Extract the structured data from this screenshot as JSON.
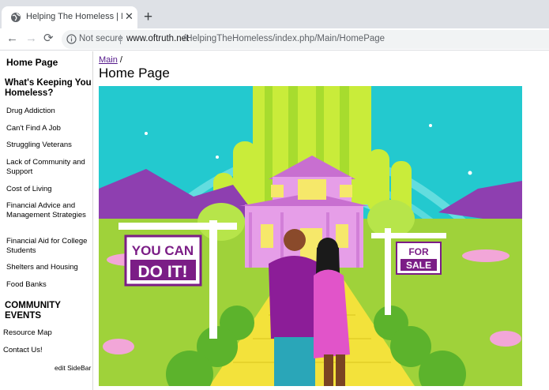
{
  "browser": {
    "tab_title": "Helping The Homeless | Main / H",
    "tab_close": "✕",
    "new_tab": "+",
    "back": "←",
    "forward": "→",
    "reload": "⟳",
    "security_label": "Not secure",
    "url_host": "www.oftruth.net",
    "url_path": "/HelpingTheHomeless/index.php/Main/HomePage"
  },
  "sidebar": {
    "home": "Home Page",
    "section1": "What's Keeping You Homeless?",
    "items": [
      "Drug Addiction",
      "Can't Find A Job",
      "Struggling Veterans",
      "Lack of Community and Support",
      "Cost of Living",
      "Financial Advice and Management Strategies",
      "Financial Aid for College Students",
      "Shelters and Housing",
      "Food Banks"
    ],
    "section2": "COMMUNITY EVENTS",
    "resource_map": "Resource Map",
    "contact": "Contact Us!",
    "edit": "edit SideBar"
  },
  "main": {
    "breadcrumb_link": "Main",
    "breadcrumb_sep": "/",
    "title": "Home Page",
    "hero": {
      "sign_left_line1": "YOU CAN",
      "sign_left_line2": "DO IT!",
      "sign_right_line1": "FOR",
      "sign_right_line2": "SALE"
    }
  },
  "colors": {
    "sky": "#23c9cf",
    "sign_purple": "#7b1d86",
    "path_yellow": "#f3e23b",
    "grass": "#9fd23a",
    "link_visited": "#551a8b"
  }
}
